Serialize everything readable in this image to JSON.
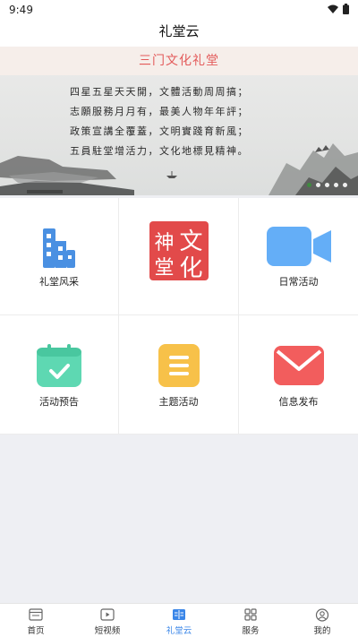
{
  "status": {
    "time": "9:49"
  },
  "appbar": {
    "title": "礼堂云"
  },
  "banner": {
    "title": "三门文化礼堂",
    "poem": [
      "四星五星天天開，文體活動周周搞；",
      "志願服務月月有，最美人物年年評；",
      "政策宣講全覆蓋，文明實踐育新風；",
      "五員駐堂增活力，文化地標見精神。"
    ],
    "dots": 5,
    "active_dot": 0
  },
  "grid": {
    "items": [
      {
        "label": "礼堂风采",
        "icon": "buildings-icon",
        "color": "#4a90e2"
      },
      {
        "label": "",
        "icon": "culture-seal-icon",
        "seal_text": [
          "神",
          "文",
          "堂",
          "化"
        ],
        "color": "#e24a4a"
      },
      {
        "label": "日常活动",
        "icon": "video-camera-icon",
        "color": "#64aef7"
      },
      {
        "label": "活动预告",
        "icon": "calendar-check-icon",
        "color": "#5ed8b2"
      },
      {
        "label": "主题活动",
        "icon": "list-icon",
        "color": "#f7c149"
      },
      {
        "label": "信息发布",
        "icon": "mail-icon",
        "color": "#f25d5d"
      }
    ]
  },
  "nav": {
    "items": [
      {
        "label": "首页",
        "icon": "home-icon"
      },
      {
        "label": "短视频",
        "icon": "play-icon"
      },
      {
        "label": "礼堂云",
        "icon": "book-icon"
      },
      {
        "label": "服务",
        "icon": "grid-icon"
      },
      {
        "label": "我的",
        "icon": "user-icon"
      }
    ],
    "active_index": 2,
    "active_color": "#3a86e8"
  }
}
